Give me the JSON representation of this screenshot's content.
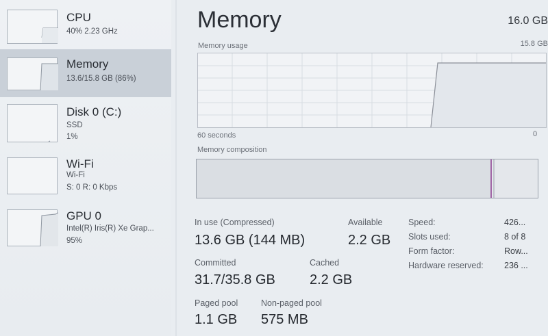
{
  "sidebar": {
    "items": [
      {
        "title": "CPU",
        "line1": "40% 2.23 GHz",
        "line2": ""
      },
      {
        "title": "Memory",
        "line1": "13.6/15.8 GB (86%)",
        "line2": ""
      },
      {
        "title": "Disk 0 (C:)",
        "line1": "SSD",
        "line2": "1%"
      },
      {
        "title": "Wi-Fi",
        "line1": "Wi-Fi",
        "line2": "S: 0 R: 0 Kbps"
      },
      {
        "title": "GPU 0",
        "line1": "Intel(R) Iris(R) Xe Grap...",
        "line2": "95%"
      }
    ]
  },
  "main": {
    "title": "Memory",
    "total": "16.0 GB",
    "usage_label": "Memory usage",
    "usage_max": "15.8 GB",
    "time_label": "60 seconds",
    "time_end": "0",
    "composition_label": "Memory composition",
    "stats": {
      "in_use_label": "In use (Compressed)",
      "in_use_value": "13.6 GB (144 MB)",
      "available_label": "Available",
      "available_value": "2.2 GB",
      "committed_label": "Committed",
      "committed_value": "31.7/35.8 GB",
      "cached_label": "Cached",
      "cached_value": "2.2 GB",
      "paged_label": "Paged pool",
      "paged_value": "1.1 GB",
      "nonpaged_label": "Non-paged pool",
      "nonpaged_value": "575 MB"
    },
    "specs": [
      {
        "label": "Speed:",
        "value": "426..."
      },
      {
        "label": "Slots used:",
        "value": "8 of 8"
      },
      {
        "label": "Form factor:",
        "value": "Row..."
      },
      {
        "label": "Hardware reserved:",
        "value": "236 ..."
      }
    ]
  },
  "colors": {
    "accent": "#8b3a8f",
    "selected_bg": "#c9d0d8",
    "graph_border": "#b9bec6"
  }
}
